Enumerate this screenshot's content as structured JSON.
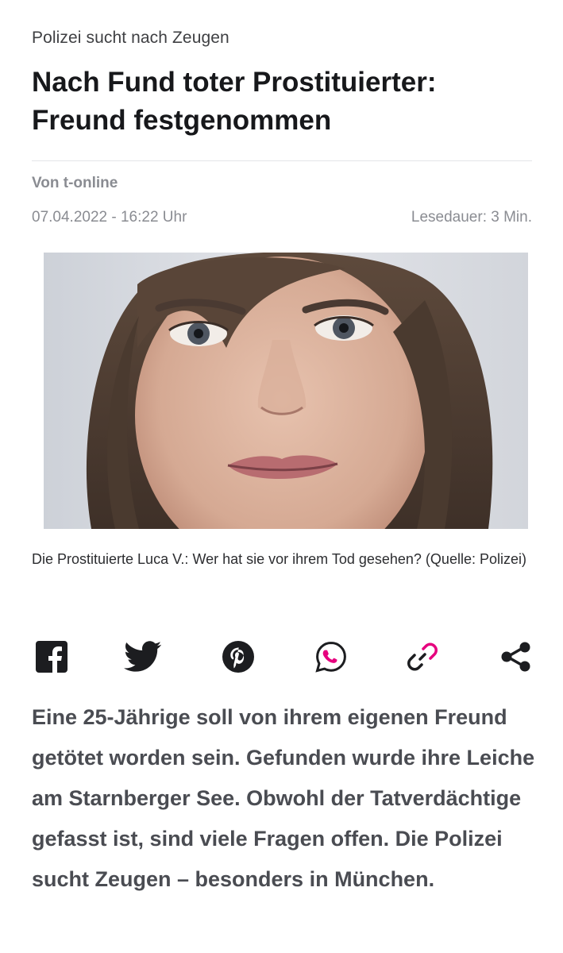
{
  "article": {
    "kicker": "Polizei sucht nach Zeugen",
    "headline": "Nach Fund toter Prostituierter: Freund festgenommen",
    "author": "Von t-online",
    "date": "07.04.2022 - 16:22 Uhr",
    "read_time": "Lesedauer: 3 Min.",
    "image_caption": "Die Prostituierte Luca V.: Wer hat sie vor ihrem Tod gesehen? (Quelle: Polizei)",
    "lead": "Eine 25-Jährige soll von ihrem eigenen Freund getötet worden sein. Gefunden wurde ihre Leiche am Starnberger See. Obwohl der Tatverdächtige gefasst ist, sind viele Fragen offen. Die Polizei sucht Zeugen – besonders in München."
  },
  "share": {
    "items": [
      {
        "icon": "facebook-icon",
        "color": "#1c1d20"
      },
      {
        "icon": "twitter-icon",
        "color": "#1c1d20"
      },
      {
        "icon": "pinterest-icon",
        "color": "#1c1d20"
      },
      {
        "icon": "whatsapp-icon",
        "color": "#e6007e"
      },
      {
        "icon": "link-icon",
        "color": "#e6007e"
      },
      {
        "icon": "share-icon",
        "color": "#1c1d20"
      }
    ]
  },
  "colors": {
    "accent": "#e6007e",
    "headline": "#17181b",
    "meta": "#8a8c92",
    "lead": "#4a4c52"
  }
}
